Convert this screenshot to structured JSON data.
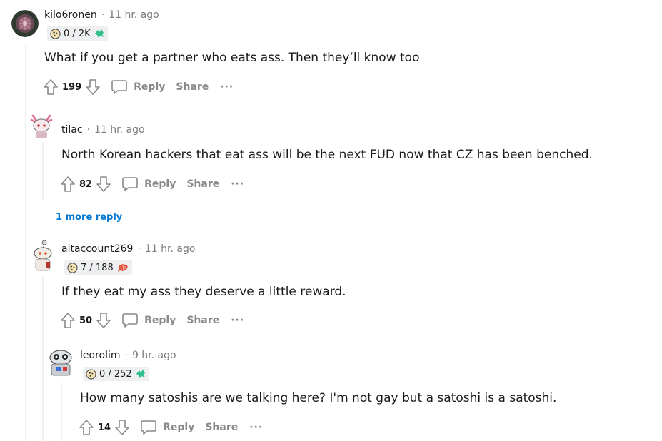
{
  "comments": [
    {
      "username": "kilo6ronen",
      "time": "11 hr. ago",
      "flair": "0 / 2K",
      "body": "What if you get a partner who eats ass. Then they’ll know too",
      "score": "199",
      "reply_label": "Reply",
      "share_label": "Share",
      "more_label": "···"
    },
    {
      "username": "tilac",
      "time": "11 hr. ago",
      "body": "North Korean hackers that eat ass will be the next FUD now that CZ has been benched.",
      "score": "82",
      "reply_label": "Reply",
      "share_label": "Share",
      "more_label": "···"
    },
    {
      "username": "altaccount269",
      "time": "11 hr. ago",
      "flair": "7 / 188",
      "body": "If they eat my ass they deserve a little reward.",
      "score": "50",
      "reply_label": "Reply",
      "share_label": "Share",
      "more_label": "···"
    },
    {
      "username": "leorolim",
      "time": "9 hr. ago",
      "flair": "0 / 252",
      "body": "How many satoshis are we talking here? I'm not gay but a satoshi is a satoshi.",
      "score": "14",
      "reply_label": "Reply",
      "share_label": "Share",
      "more_label": "···"
    }
  ],
  "more_replies_label": "1 more reply",
  "dot": "·",
  "colors": {
    "link": "#0079d3",
    "muted": "#878a8c",
    "text": "#1a1a1b",
    "thread_line": "#edeff1",
    "flair_bg": "#edeff1"
  },
  "icons": [
    "upvote-icon",
    "downvote-icon",
    "comment-bubble-icon",
    "moon-coin-icon",
    "kudos-leaf-icon",
    "shrimp-icon"
  ]
}
